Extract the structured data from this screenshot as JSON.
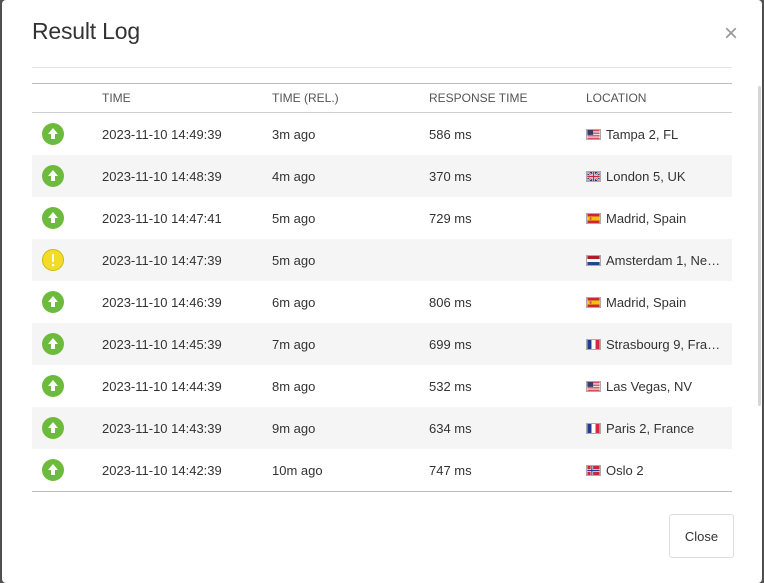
{
  "modal": {
    "title": "Result Log",
    "close_icon": "×",
    "close_button_label": "Close"
  },
  "table": {
    "columns": [
      "",
      "TIME",
      "TIME (REL.)",
      "RESPONSE TIME",
      "LOCATION"
    ],
    "rows": [
      {
        "status": "up",
        "time": "2023-11-10 14:49:39",
        "rel": "3m ago",
        "response": "586 ms",
        "flag": "us",
        "location": "Tampa 2, FL"
      },
      {
        "status": "up",
        "time": "2023-11-10 14:48:39",
        "rel": "4m ago",
        "response": "370 ms",
        "flag": "uk",
        "location": "London 5, UK"
      },
      {
        "status": "up",
        "time": "2023-11-10 14:47:41",
        "rel": "5m ago",
        "response": "729 ms",
        "flag": "es",
        "location": "Madrid, Spain"
      },
      {
        "status": "warning",
        "time": "2023-11-10 14:47:39",
        "rel": "5m ago",
        "response": "",
        "flag": "nl",
        "location": "Amsterdam 1, Ne…"
      },
      {
        "status": "up",
        "time": "2023-11-10 14:46:39",
        "rel": "6m ago",
        "response": "806 ms",
        "flag": "es",
        "location": "Madrid, Spain"
      },
      {
        "status": "up",
        "time": "2023-11-10 14:45:39",
        "rel": "7m ago",
        "response": "699 ms",
        "flag": "fr",
        "location": "Strasbourg 9, Fra…"
      },
      {
        "status": "up",
        "time": "2023-11-10 14:44:39",
        "rel": "8m ago",
        "response": "532 ms",
        "flag": "us",
        "location": "Las Vegas, NV"
      },
      {
        "status": "up",
        "time": "2023-11-10 14:43:39",
        "rel": "9m ago",
        "response": "634 ms",
        "flag": "fr",
        "location": "Paris 2, France"
      },
      {
        "status": "up",
        "time": "2023-11-10 14:42:39",
        "rel": "10m ago",
        "response": "747 ms",
        "flag": "no",
        "location": "Oslo 2"
      }
    ]
  },
  "colors": {
    "status_up": "#6dbb3c",
    "status_warning": "#f3dc27",
    "row_stripe": "#f5f5f5"
  },
  "icons": {
    "up": "arrow-up-circle-icon",
    "warning": "exclamation-circle-icon"
  }
}
